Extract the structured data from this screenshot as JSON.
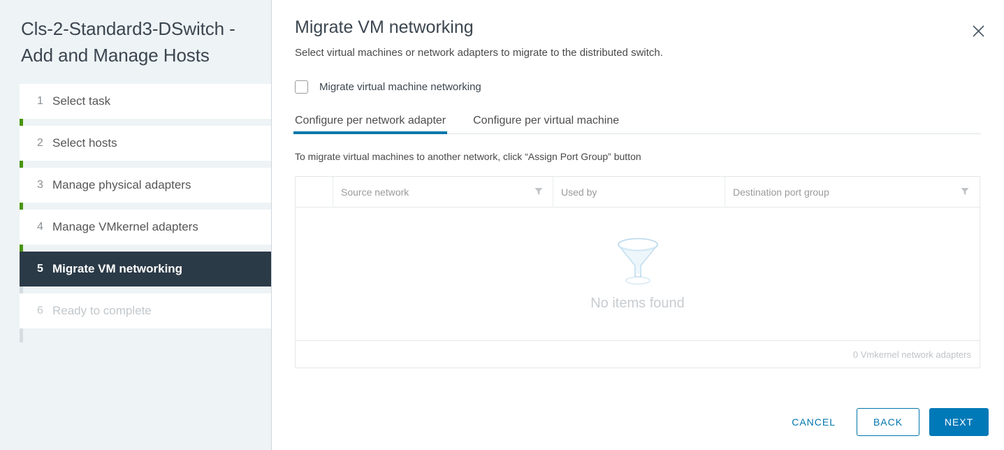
{
  "sidebar": {
    "title": "Cls-2-Standard3-DSwitch - Add and Manage Hosts",
    "steps": [
      {
        "num": "1",
        "label": "Select task",
        "state": "complete"
      },
      {
        "num": "2",
        "label": "Select hosts",
        "state": "complete"
      },
      {
        "num": "3",
        "label": "Manage physical adapters",
        "state": "complete"
      },
      {
        "num": "4",
        "label": "Manage VMkernel adapters",
        "state": "complete"
      },
      {
        "num": "5",
        "label": "Migrate VM networking",
        "state": "active"
      },
      {
        "num": "6",
        "label": "Ready to complete",
        "state": "disabled"
      }
    ],
    "progress_color": "#48940f",
    "active_color": "#2b3a47"
  },
  "main": {
    "title": "Migrate VM networking",
    "subtitle": "Select virtual machines or network adapters to migrate to the distributed switch.",
    "close_icon": "close-icon",
    "checkbox": {
      "label": "Migrate virtual machine networking",
      "checked": false
    },
    "tabs": [
      {
        "label": "Configure per network adapter",
        "active": true
      },
      {
        "label": "Configure per virtual machine",
        "active": false
      }
    ],
    "hint": "To migrate virtual machines to another network, click “Assign Port Group” button",
    "table": {
      "columns": [
        {
          "label": "",
          "filter": false
        },
        {
          "label": "Source network",
          "filter": true
        },
        {
          "label": "Used by",
          "filter": false
        },
        {
          "label": "Destination port group",
          "filter": true
        }
      ],
      "rows": [],
      "empty_text": "No items found",
      "empty_icon": "funnel-icon",
      "footer_count": "0 Vmkernel network adapters"
    }
  },
  "footer": {
    "cancel_label": "CANCEL",
    "back_label": "BACK",
    "next_label": "NEXT",
    "accent_color": "#0079b8"
  }
}
